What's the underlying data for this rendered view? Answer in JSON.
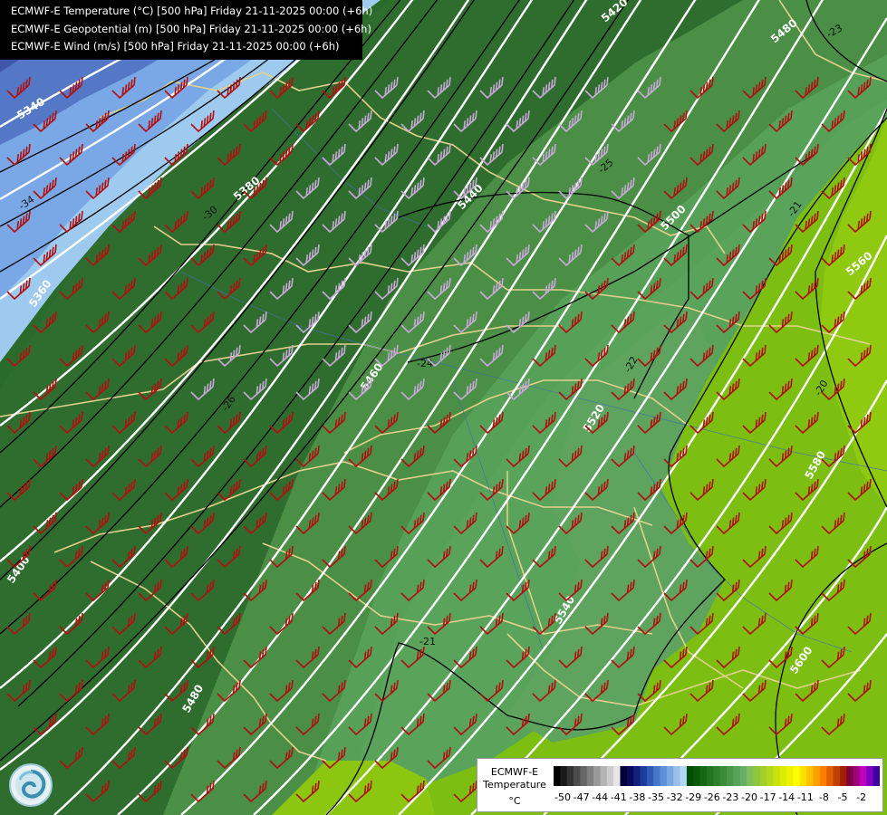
{
  "header": {
    "line1": "ECMWF-E Temperature (°C) [500 hPa] Friday 21-11-2025 00:00 (+6h)",
    "line2": "ECMWF-E Geopotential (m) [500 hPa] Friday 21-11-2025 00:00 (+6h)",
    "line3": "ECMWF-E Wind (m/s) [500 hPa] Friday 21-11-2025 00:00 (+6h)"
  },
  "legend": {
    "title_line1": "ECMWF-E",
    "title_line2": "Temperature",
    "unit": "°C",
    "tick_labels": [
      "-50",
      "-47",
      "-44",
      "-41",
      "-38",
      "-35",
      "-32",
      "-29",
      "-26",
      "-23",
      "-20",
      "-17",
      "-14",
      "-11",
      "-8",
      "-5",
      "-2"
    ],
    "colors": [
      "#000000",
      "#1a1a1a",
      "#333333",
      "#4d4d4d",
      "#666666",
      "#808080",
      "#999999",
      "#b3b3b3",
      "#cccccc",
      "#e6e6e6",
      "#00003a",
      "#0a0a5c",
      "#14207e",
      "#1f3d9c",
      "#2f5bb5",
      "#4677c9",
      "#5f8fd6",
      "#7ba8e0",
      "#97c0ea",
      "#b3d8f4",
      "#004d00",
      "#0b5a0b",
      "#166716",
      "#217421",
      "#2d802d",
      "#3a8c3a",
      "#489848",
      "#57a357",
      "#67ae67",
      "#7fc05a",
      "#8ec63f",
      "#9fcf2a",
      "#b3d91a",
      "#c8e20e",
      "#dcec05",
      "#eef200",
      "#ffff00",
      "#ffe000",
      "#ffc000",
      "#ffa000",
      "#ff8000",
      "#e06000",
      "#c04000",
      "#a02000",
      "#800040",
      "#a0007f",
      "#c000bf",
      "#8000c0",
      "#4000a0"
    ]
  },
  "map_labels": {
    "heights": [
      "5340",
      "5380",
      "5420",
      "5440",
      "5460",
      "5480",
      "5500",
      "5520",
      "5540",
      "5560",
      "5580",
      "5600",
      "5400",
      "5360"
    ],
    "temps": [
      "-34",
      "-30",
      "-26",
      "-25",
      "-24",
      "-23",
      "-22",
      "-21",
      "-20"
    ]
  }
}
